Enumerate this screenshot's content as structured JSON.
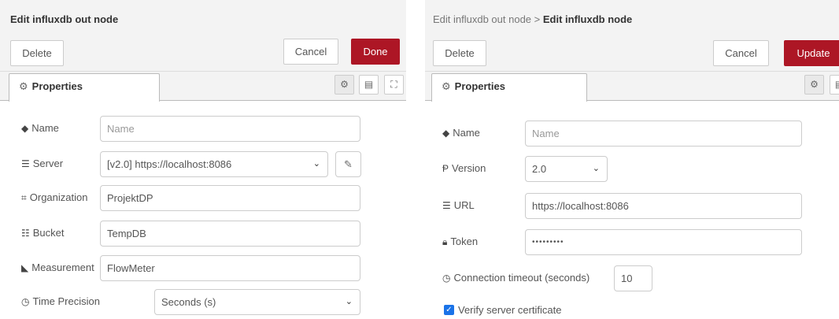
{
  "left": {
    "title": "Edit influxdb out node",
    "buttons": {
      "delete": "Delete",
      "cancel": "Cancel",
      "done": "Done"
    },
    "tab": {
      "icon": "gear-icon",
      "label": "Properties"
    },
    "tab_icons": [
      "gear-icon",
      "description-icon",
      "appearance-icon"
    ],
    "fields": {
      "name": {
        "label": "Name",
        "icon": "tag-icon",
        "placeholder": "Name"
      },
      "server": {
        "label": "Server",
        "icon": "server-icon",
        "value": "[v2.0] https://localhost:8086"
      },
      "organization": {
        "label": "Organization",
        "icon": "sitemap-icon",
        "value": "ProjektDP"
      },
      "bucket": {
        "label": "Bucket",
        "icon": "database-icon",
        "value": "TempDB"
      },
      "measurement": {
        "label": "Measurement",
        "icon": "rss-icon",
        "value": "FlowMeter"
      },
      "time_precision": {
        "label": "Time Precision",
        "icon": "clock-icon",
        "value": "Seconds (s)"
      }
    }
  },
  "right": {
    "breadcrumb": "Edit influxdb out node",
    "separator": ">",
    "title": "Edit influxdb node",
    "buttons": {
      "delete": "Delete",
      "cancel": "Cancel",
      "update": "Update"
    },
    "tab": {
      "icon": "gear-icon",
      "label": "Properties"
    },
    "tab_icons": [
      "gear-icon",
      "description-icon"
    ],
    "fields": {
      "name": {
        "label": "Name",
        "icon": "tag-icon",
        "placeholder": "Name"
      },
      "version": {
        "label": "Version",
        "icon": "code-fork-icon",
        "value": "2.0"
      },
      "url": {
        "label": "URL",
        "icon": "server-icon",
        "value": "https://localhost:8086"
      },
      "token": {
        "label": "Token",
        "icon": "lock-icon",
        "value": "•••••••••"
      },
      "connection_timeout": {
        "label": "Connection timeout (seconds)",
        "icon": "clock-icon",
        "value": "10"
      },
      "verify_cert": {
        "label": "Verify server certificate",
        "checked": true
      }
    }
  },
  "colors": {
    "primary": "#ad1625",
    "header_bg": "#f3f3f3",
    "checkbox": "#1a73e8"
  }
}
